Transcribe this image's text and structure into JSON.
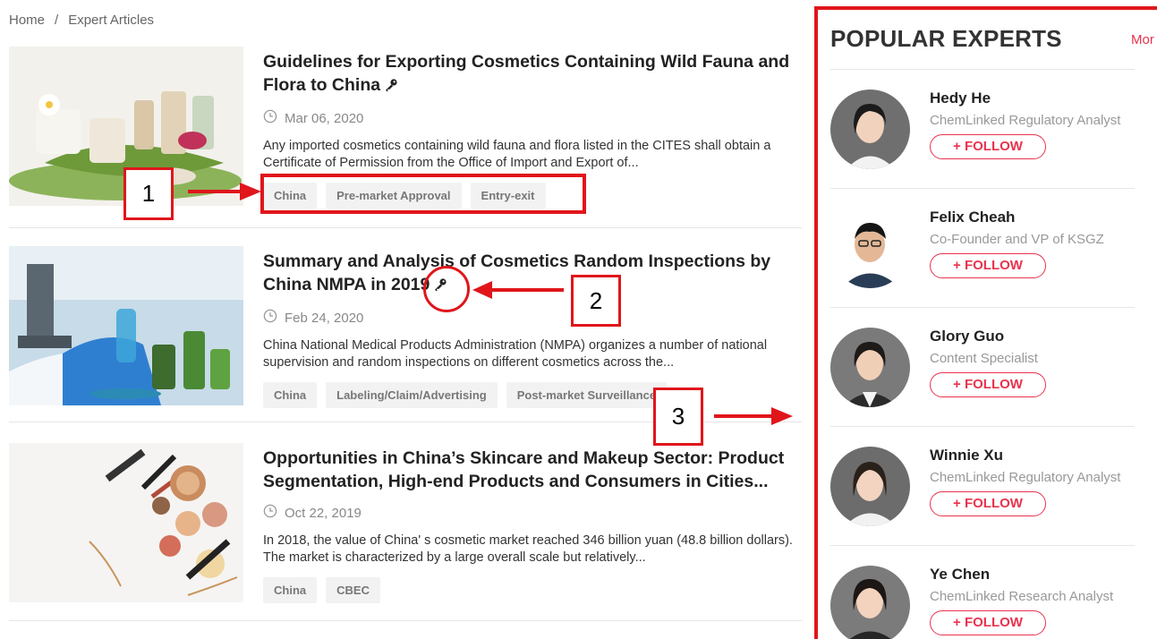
{
  "breadcrumb": {
    "home": "Home",
    "separator": "/",
    "current": "Expert Articles"
  },
  "articles": [
    {
      "title": "Guidelines for Exporting Cosmetics Containing Wild Fauna and Flora to China",
      "date": "Mar 06, 2020",
      "summary": "Any imported cosmetics containing wild fauna and flora listed in the CITES shall obtain a Certificate of Permission from the Office of Import and Export of...",
      "tags": [
        "China",
        "Pre-market Approval",
        "Entry-exit"
      ],
      "key_icon": "key-icon"
    },
    {
      "title": "Summary and Analysis of Cosmetics Random Inspections by China NMPA in 2019",
      "date": "Feb 24, 2020",
      "summary": "China National Medical Products Administration (NMPA) organizes a number of national supervision and random inspections on different cosmetics across the...",
      "tags": [
        "China",
        "Labeling/Claim/Advertising",
        "Post-market Surveillance"
      ],
      "key_icon": "key-icon"
    },
    {
      "title": "Opportunities in China’s Skincare and Makeup Sector: Product Segmentation, High-end Products and Consumers in Cities...",
      "date": "Oct 22, 2019",
      "summary": "In 2018, the value of China' s cosmetic market reached 346 billion yuan (48.8 billion dollars). The market is characterized by a large overall scale but relatively...",
      "tags": [
        "China",
        "CBEC"
      ]
    }
  ],
  "sidebar": {
    "title": "POPULAR EXPERTS",
    "more": "Mor",
    "follow_label": "+ FOLLOW",
    "experts": [
      {
        "name": "Hedy He",
        "role": "ChemLinked Regulatory Analyst"
      },
      {
        "name": "Felix Cheah",
        "role": "Co-Founder and VP of KSGZ"
      },
      {
        "name": "Glory Guo",
        "role": "Content Specialist"
      },
      {
        "name": "Winnie Xu",
        "role": "ChemLinked Regulatory Analyst"
      },
      {
        "name": "Ye Chen",
        "role": "ChemLinked Research Analyst"
      }
    ]
  },
  "annotations": {
    "label1": "1",
    "label2": "2",
    "label3": "3"
  },
  "colors": {
    "accent": "#e8334d",
    "annotation": "#e0161b",
    "tag_bg": "#f2f2f2"
  }
}
